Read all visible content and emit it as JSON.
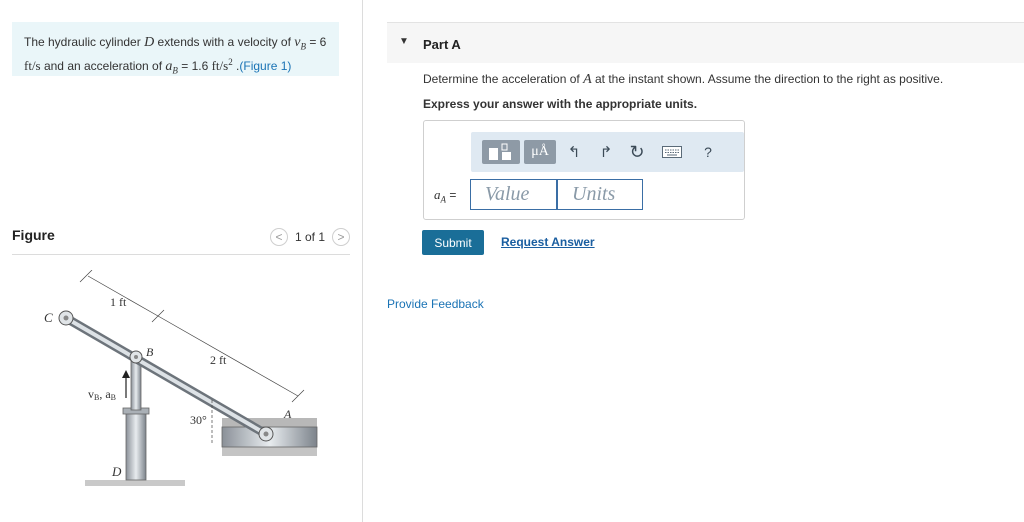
{
  "problem": {
    "t1": "The hydraulic cylinder ",
    "var_d": "D",
    "t2": " extends with a velocity of ",
    "vb": "v",
    "vb_sub": "B",
    "t3": " = 6",
    "unit_ft_s": "ft/s",
    "t4": " and an acceleration of ",
    "ab": "a",
    "ab_sub": "B",
    "t5": " = 1.6 ",
    "unit_ft_s2": "ft/s",
    "unit_sup": "2",
    "t6": " .",
    "link": "(Figure 1)"
  },
  "figure": {
    "title": "Figure",
    "pager": "1 of 1",
    "prev": "<",
    "next": ">",
    "labels": {
      "c": "C",
      "b": "B",
      "a": "A",
      "d": "D",
      "one_ft": "1 ft",
      "two_ft": "2 ft",
      "angle": "30°",
      "vbab": "v",
      "vbab_sub1": "B",
      "vbab_mid": ", a",
      "vbab_sub2": "B"
    }
  },
  "part": {
    "title": "Part A",
    "caret": "▼"
  },
  "question": {
    "q1a": "Determine the acceleration of ",
    "q1var": "A",
    "q1b": " at the instant shown. Assume the direction to the right as positive.",
    "q2": "Express your answer with the appropriate units."
  },
  "toolbar": {
    "mu": "μÅ",
    "undo": "↰",
    "redo": "↱",
    "reset": "↻",
    "help": "?"
  },
  "answer": {
    "label_var": "a",
    "label_sub": "A",
    "label_eq": " =",
    "value_placeholder": "Value",
    "units_placeholder": "Units"
  },
  "actions": {
    "submit": "Submit",
    "request": "Request Answer",
    "feedback": "Provide Feedback"
  }
}
